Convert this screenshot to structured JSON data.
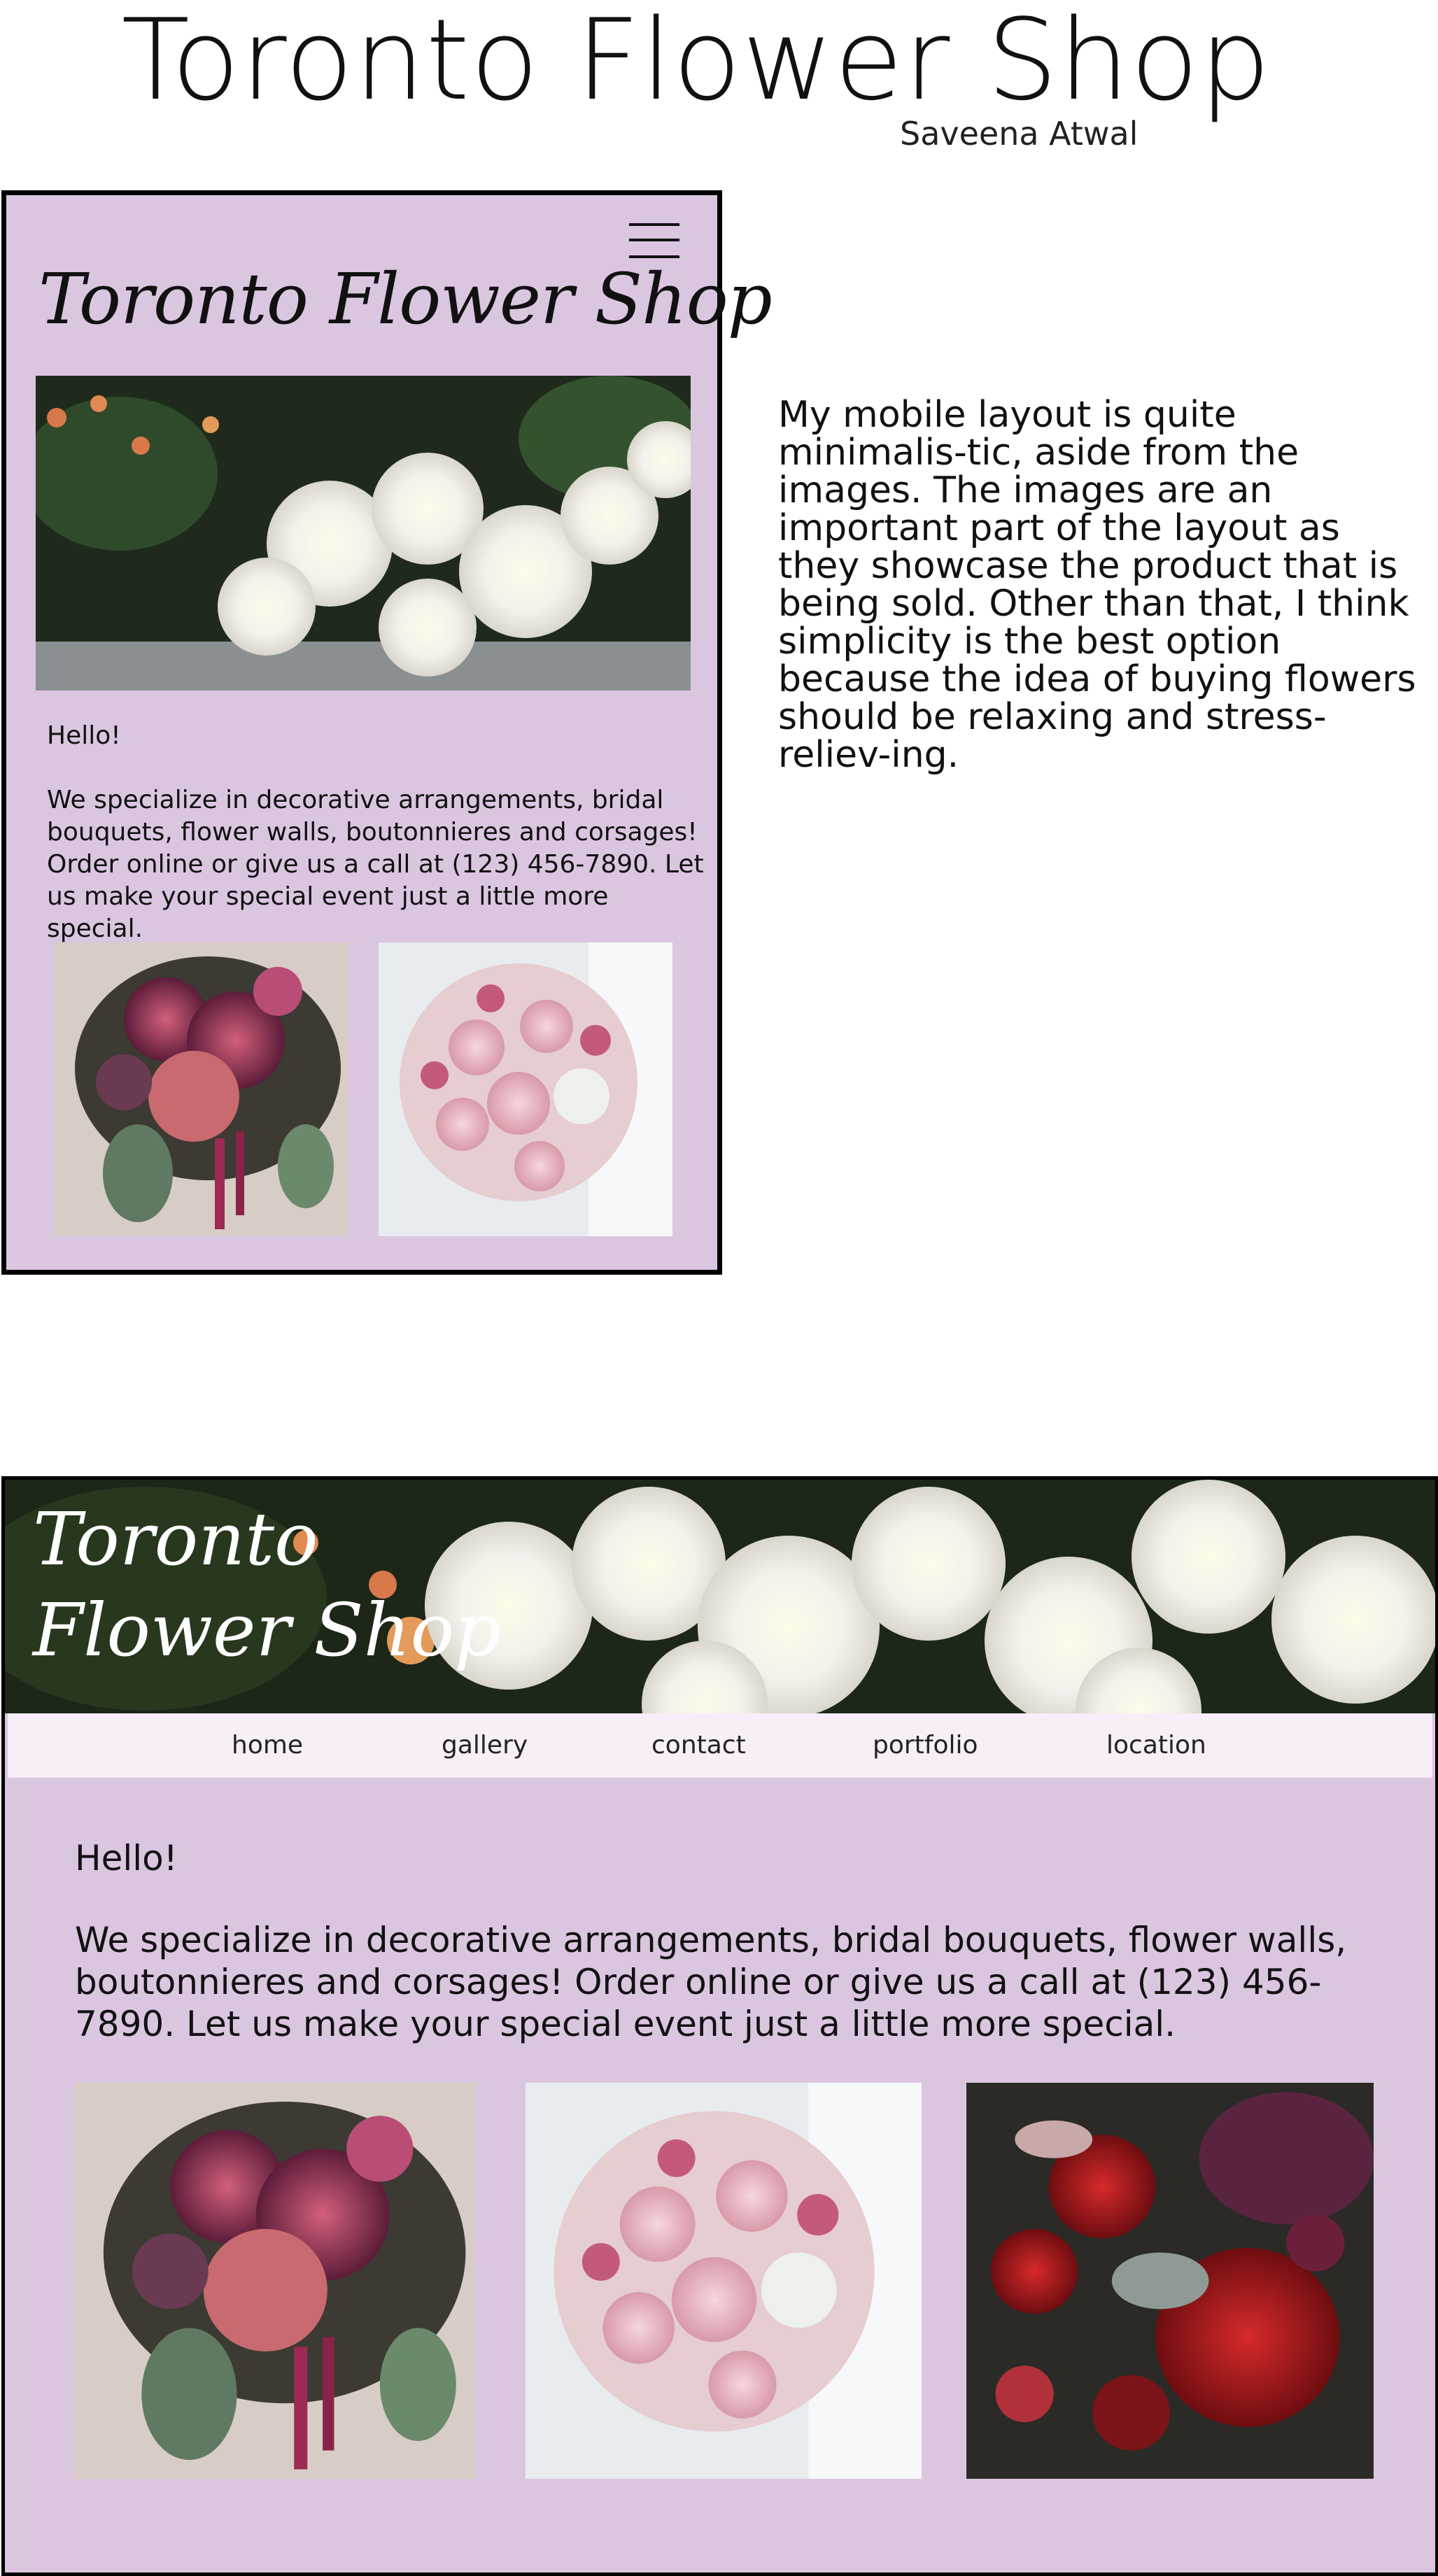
{
  "page": {
    "title": "Toronto Flower Shop",
    "author": "Saveena Atwal",
    "description": "My mobile layout is quite minimalis-tic, aside from the images. The images are an important part of the layout as they showcase the product that is being sold. Other than that, I think simplicity is the best option because the idea of buying flowers should be relaxing and stress-reliev-ing."
  },
  "mobile": {
    "brand": "Toronto Flower Shop",
    "menu_icon": "hamburger-menu-icon",
    "greeting": "Hello!",
    "body": "We specialize in decorative arrangements, bridal bouquets, flower walls, boutonnieres and corsages! Order online or give us a call at (123) 456-7890. Let us make your special event just a little more special.",
    "images": [
      "white lily bouquet photo",
      "burgundy bouquet photo",
      "pink bridal bouquet photo"
    ]
  },
  "desktop": {
    "brand_line1": "Toronto",
    "brand_line2": "Flower Shop",
    "nav": [
      {
        "label": "home"
      },
      {
        "label": "gallery"
      },
      {
        "label": "contact"
      },
      {
        "label": "portfolio"
      },
      {
        "label": "location"
      }
    ],
    "greeting": "Hello!",
    "body": "We specialize in decorative arrangements, bridal bouquets, flower walls, boutonnieres and corsages! Order online or give us a call at (123) 456-7890. Let us make your special event just a little more special.",
    "images": [
      "burgundy bouquet photo",
      "pink bridal bouquet photo",
      "red roses photo"
    ]
  },
  "colors": {
    "lavender": "#dbc6e0",
    "nav_bg": "#f7eef7",
    "border": "#000000"
  }
}
